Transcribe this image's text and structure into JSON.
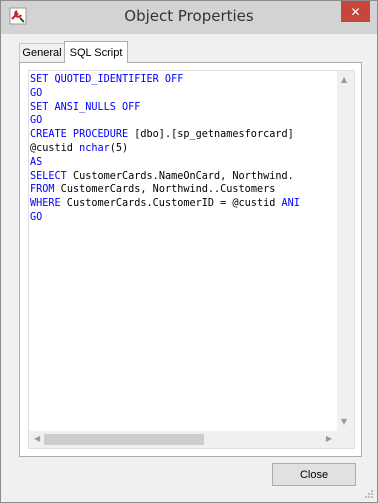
{
  "window": {
    "title": "Object Properties",
    "close_glyph": "✕"
  },
  "tabs": [
    {
      "label": "General"
    },
    {
      "label": "SQL Script"
    }
  ],
  "sql_script": {
    "lines": [
      [
        {
          "t": "SET QUOTED_IDENTIFIER OFF",
          "k": true
        }
      ],
      [
        {
          "t": "GO",
          "k": true
        }
      ],
      [
        {
          "t": "SET ANSI_NULLS OFF",
          "k": true
        }
      ],
      [
        {
          "t": "GO",
          "k": true
        }
      ],
      [
        {
          "t": "CREATE PROCEDURE",
          "k": true
        },
        {
          "t": " [dbo].[sp_getnamesforcard]",
          "k": false
        }
      ],
      [
        {
          "t": "@custid ",
          "k": false
        },
        {
          "t": "nchar",
          "k": true
        },
        {
          "t": "(5)",
          "k": false
        }
      ],
      [
        {
          "t": "AS",
          "k": true
        }
      ],
      [
        {
          "t": "SELECT",
          "k": true
        },
        {
          "t": " CustomerCards.NameOnCard, Northwind.",
          "k": false
        }
      ],
      [
        {
          "t": "FROM",
          "k": true
        },
        {
          "t": " CustomerCards, Northwind..Customers",
          "k": false
        }
      ],
      [
        {
          "t": "WHERE",
          "k": true
        },
        {
          "t": " CustomerCards.CustomerID = @custid ",
          "k": false
        },
        {
          "t": "ANI",
          "k": true
        }
      ],
      [
        {
          "t": "GO",
          "k": true
        }
      ]
    ]
  },
  "buttons": {
    "close": "Close"
  },
  "colors": {
    "keyword": "#0000ff",
    "close_button": "#c7463b"
  },
  "icons": {
    "app": "wrench-icon",
    "close": "close-icon"
  }
}
